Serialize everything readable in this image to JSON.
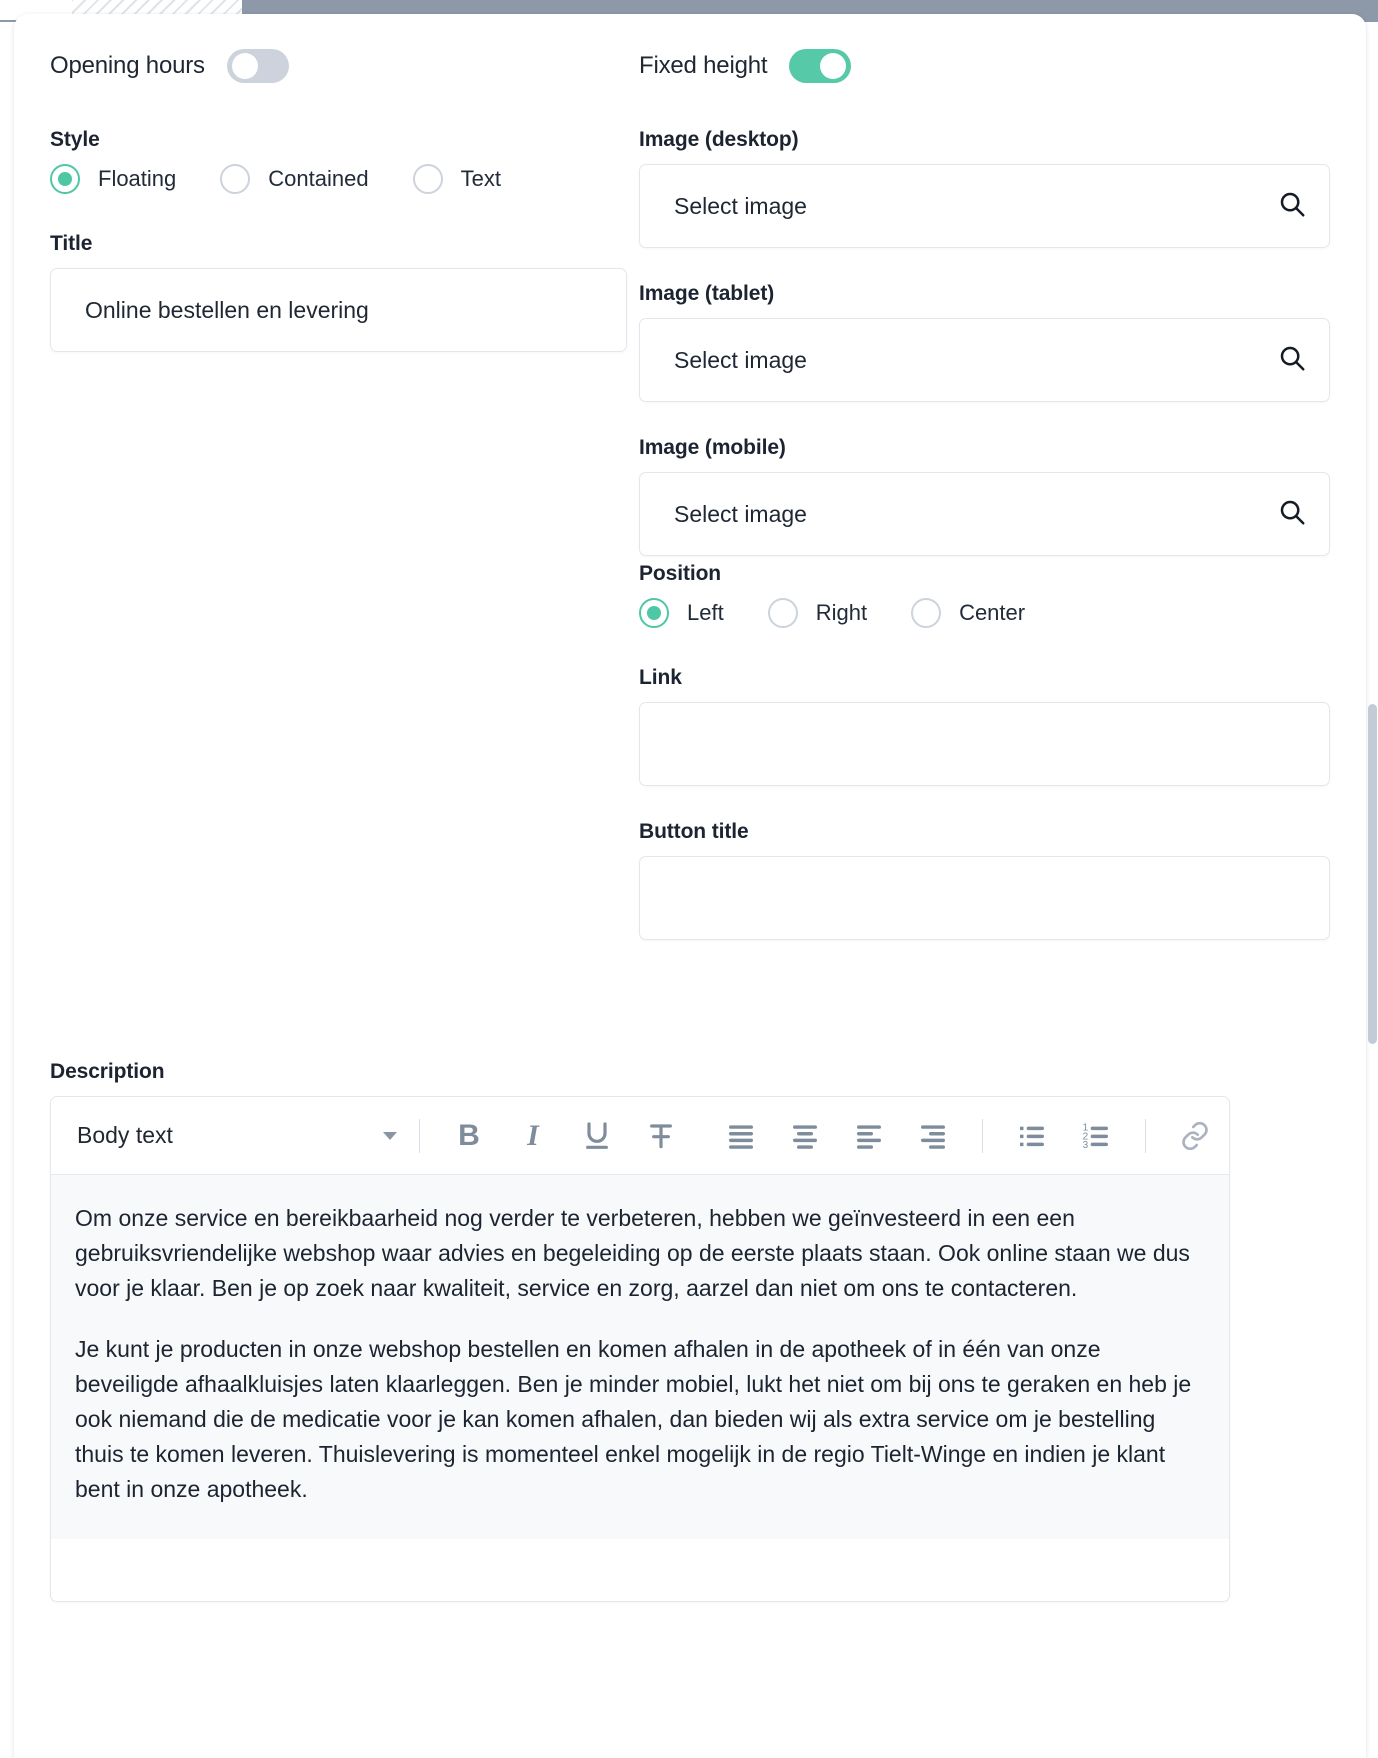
{
  "panel": {
    "toggles": [
      {
        "label": "Opening hours",
        "state": "off"
      },
      {
        "label": "Fixed height",
        "state": "on"
      }
    ],
    "style_field": {
      "label": "Style",
      "options": [
        {
          "label": "Floating",
          "selected": true
        },
        {
          "label": "Contained",
          "selected": false
        },
        {
          "label": "Text",
          "selected": false
        }
      ]
    },
    "title_field": {
      "label": "Title",
      "value": "Online bestellen en levering",
      "placeholder": ""
    },
    "image_desktop": {
      "label": "Image (desktop)",
      "value": "Select image",
      "icon": "search-icon"
    },
    "image_tablet": {
      "label": "Image (tablet)",
      "value": "Select image",
      "icon": "search-icon"
    },
    "image_mobile": {
      "label": "Image (mobile)",
      "value": "Select image",
      "icon": "search-icon"
    },
    "position_field": {
      "label": "Position",
      "options": [
        {
          "label": "Left",
          "selected": true
        },
        {
          "label": "Right",
          "selected": false
        },
        {
          "label": "Center",
          "selected": false
        }
      ]
    },
    "link_field": {
      "label": "Link",
      "value": "",
      "placeholder": ""
    },
    "button_title_field": {
      "label": "Button title",
      "value": "",
      "placeholder": ""
    },
    "description": {
      "label": "Description",
      "editor": {
        "style_selected": "Body text",
        "tools": [
          {
            "name": "bold-icon",
            "glyph": "B"
          },
          {
            "name": "italic-icon",
            "glyph": "I"
          },
          {
            "name": "underline-icon",
            "glyph": "U"
          },
          {
            "name": "strikethrough-icon",
            "glyph": "S"
          },
          {
            "name": "align-justify-icon",
            "glyph": ""
          },
          {
            "name": "align-center-icon",
            "glyph": ""
          },
          {
            "name": "align-left-icon",
            "glyph": ""
          },
          {
            "name": "align-right-icon",
            "glyph": ""
          },
          {
            "name": "bullet-list-icon",
            "glyph": ""
          },
          {
            "name": "numbered-list-icon",
            "glyph": ""
          },
          {
            "name": "link-icon",
            "glyph": ""
          }
        ]
      },
      "paragraphs": [
        "Om onze service en bereikbaarheid nog verder te verbeteren, hebben we geïnvesteerd in een een gebruiksvriendelijke webshop waar advies en begeleiding op de eerste plaats staan. Ook online staan we dus voor je klaar. Ben je op zoek naar kwaliteit, service en zorg, aarzel dan niet om ons te contacteren.",
        "Je kunt je producten in onze webshop bestellen en komen afhalen in de apotheek of in één van onze beveiligde afhaalkluisjes laten klaarleggen. Ben je minder mobiel, lukt het niet om bij ons te geraken en heb je ook niemand die de medicatie voor je kan komen afhalen, dan bieden wij als extra service om je bestelling thuis te komen leveren. Thuislevering is momenteel enkel mogelijk in de regio Tielt-Winge en indien je klant bent in onze apotheek."
      ]
    }
  },
  "colors": {
    "accent_green": "#4ec7a5",
    "toggle_off": "#ccd3dc",
    "text_primary": "#1b2430",
    "border": "#e2e7ee",
    "topbar": "#8d99a8"
  }
}
